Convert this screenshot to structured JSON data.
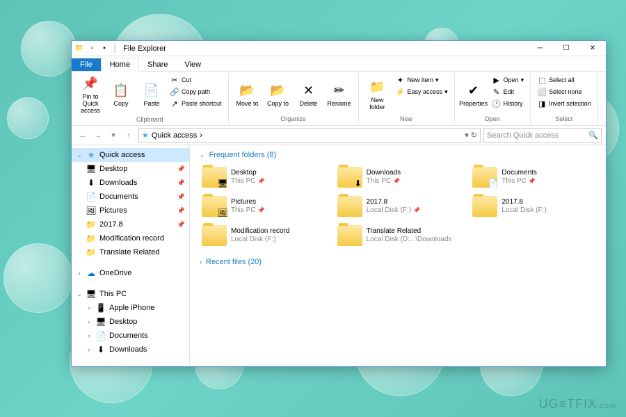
{
  "window": {
    "title": "File Explorer",
    "tabs": {
      "file": "File",
      "home": "Home",
      "share": "Share",
      "view": "View"
    }
  },
  "ribbon": {
    "clipboard": {
      "label": "Clipboard",
      "pin": "Pin to Quick access",
      "copy": "Copy",
      "paste": "Paste",
      "cut": "Cut",
      "copypath": "Copy path",
      "pastesc": "Paste shortcut"
    },
    "organize": {
      "label": "Organize",
      "moveto": "Move to",
      "copyto": "Copy to",
      "delete": "Delete",
      "rename": "Rename"
    },
    "new": {
      "label": "New",
      "newfolder": "New folder",
      "newitem": "New item",
      "easyaccess": "Easy access"
    },
    "open": {
      "label": "Open",
      "properties": "Properties",
      "open": "Open",
      "edit": "Edit",
      "history": "History"
    },
    "select": {
      "label": "Select",
      "all": "Select all",
      "none": "Select none",
      "invert": "Invert selection"
    }
  },
  "address": {
    "location": "Quick access",
    "arrow": "›"
  },
  "search": {
    "placeholder": "Search Quick access"
  },
  "sidebar": {
    "quickaccess": "Quick access",
    "items": [
      {
        "label": "Desktop",
        "icon": "🖥",
        "pinned": true
      },
      {
        "label": "Downloads",
        "icon": "⬇",
        "pinned": true
      },
      {
        "label": "Documents",
        "icon": "📄",
        "pinned": true
      },
      {
        "label": "Pictures",
        "icon": "🖼",
        "pinned": true
      },
      {
        "label": "2017.8",
        "icon": "📁",
        "pinned": true
      },
      {
        "label": "Modification record",
        "icon": "📁",
        "pinned": false
      },
      {
        "label": "Translate Related",
        "icon": "📁",
        "pinned": false
      }
    ],
    "onedrive": "OneDrive",
    "thispc": "This PC",
    "pcitems": [
      {
        "label": "Apple iPhone",
        "icon": "📱"
      },
      {
        "label": "Desktop",
        "icon": "🖥"
      },
      {
        "label": "Documents",
        "icon": "📄"
      },
      {
        "label": "Downloads",
        "icon": "⬇"
      }
    ]
  },
  "content": {
    "freq_header": "Frequent folders (8)",
    "recent_header": "Recent files (20)",
    "folders": [
      {
        "name": "Desktop",
        "loc": "This PC",
        "overlay": "🖥",
        "pinned": true
      },
      {
        "name": "Downloads",
        "loc": "This PC",
        "overlay": "⬇",
        "pinned": true
      },
      {
        "name": "Documents",
        "loc": "This PC",
        "overlay": "📄",
        "pinned": true
      },
      {
        "name": "Pictures",
        "loc": "This PC",
        "overlay": "🖼",
        "pinned": true
      },
      {
        "name": "2017.8",
        "loc": "Local Disk (F:)",
        "overlay": "",
        "pinned": true
      },
      {
        "name": "2017.8",
        "loc": "Local Disk (F:)",
        "overlay": "",
        "pinned": false
      },
      {
        "name": "Modification record",
        "loc": "Local Disk (F:)",
        "overlay": "",
        "pinned": false
      },
      {
        "name": "Translate Related",
        "loc": "Local Disk (D:...\\Downloads",
        "overlay": "",
        "pinned": false
      }
    ]
  },
  "watermark": {
    "brand": "UG≡TFIX",
    "suffix": ".com"
  }
}
